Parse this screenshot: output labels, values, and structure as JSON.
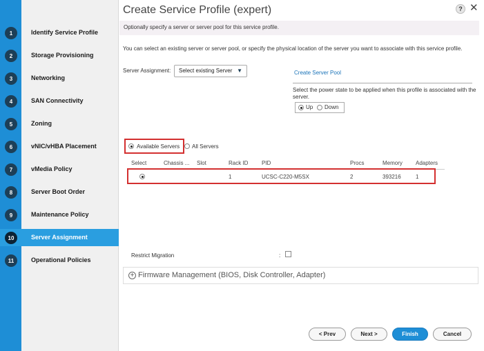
{
  "dialog": {
    "title": "Create Service Profile (expert)",
    "help_label": "?",
    "close_label": "✕"
  },
  "steps": [
    {
      "num": "1",
      "label": "Identify Service Profile",
      "active": false
    },
    {
      "num": "2",
      "label": "Storage Provisioning",
      "active": false
    },
    {
      "num": "3",
      "label": "Networking",
      "active": false
    },
    {
      "num": "4",
      "label": "SAN Connectivity",
      "active": false
    },
    {
      "num": "5",
      "label": "Zoning",
      "active": false
    },
    {
      "num": "6",
      "label": "vNIC/vHBA Placement",
      "active": false
    },
    {
      "num": "7",
      "label": "vMedia Policy",
      "active": false
    },
    {
      "num": "8",
      "label": "Server Boot Order",
      "active": false
    },
    {
      "num": "9",
      "label": "Maintenance Policy",
      "active": false
    },
    {
      "num": "10",
      "label": "Server Assignment",
      "active": true
    },
    {
      "num": "11",
      "label": "Operational Policies",
      "active": false
    }
  ],
  "main": {
    "hint": "Optionally specify a server or server pool for this service profile.",
    "description": "You can select an existing server or server pool, or specify the physical location of the server you want to associate with this service profile.",
    "server_assignment_label": "Server Assignment:",
    "server_assignment_value": "Select existing Server",
    "create_pool_link": "Create Server Pool",
    "power_state_desc": "Select the power state to be applied when this profile is associated with the server.",
    "power_up": "Up",
    "power_down": "Down",
    "filter_available": "Available Servers",
    "filter_all": "All Servers",
    "table": {
      "headers": [
        "Select",
        "Chassis ...",
        "Slot",
        "Rack ID",
        "PID",
        "Procs",
        "Memory",
        "Adapters"
      ],
      "rows": [
        {
          "rack_id": "1",
          "pid": "UCSC-C220-M5SX",
          "procs": "2",
          "memory": "393216",
          "adapters": "1"
        }
      ]
    },
    "restrict_migration_label": "Restrict Migration",
    "restrict_migration_colon": ":",
    "firmware_title": "Firmware Management (BIOS, Disk Controller, Adapter)",
    "firmware_plus": "+"
  },
  "footer": {
    "prev": "< Prev",
    "next": "Next >",
    "finish": "Finish",
    "cancel": "Cancel"
  },
  "colors": {
    "accent": "#1e8ed6",
    "highlight_box": "#d32f2f"
  }
}
